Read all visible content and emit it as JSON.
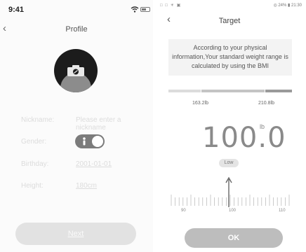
{
  "profile_screen": {
    "status": {
      "time": "9:41"
    },
    "title": "Profile",
    "fields": {
      "nickname": {
        "label": "Nickname:",
        "placeholder": "Please enter a nickname"
      },
      "gender": {
        "label": "Gender:",
        "value": "male"
      },
      "birthday": {
        "label": "Birthday:",
        "value": "2001-01-01"
      },
      "height": {
        "label": "Height:",
        "value": "180cm"
      }
    },
    "next_label": "Next"
  },
  "target_screen": {
    "status": {
      "left_icons": "□ □ ☀ ▣",
      "right": "◎ 24% ▮ 21:30"
    },
    "title": "Target",
    "info_text": "According to your physical information,Your standard weight range is calculated by using the BMI",
    "range": {
      "min_label": "163.2lb",
      "max_label": "210.8lb"
    },
    "weight": {
      "value": "100.0",
      "unit": "lb",
      "status": "Low"
    },
    "ruler": {
      "labels": [
        "90",
        "100",
        "110"
      ],
      "selected": 100,
      "min": 90,
      "max": 110
    },
    "ok_label": "OK"
  },
  "colors": {
    "accent_gray": "#8a8a8a",
    "button_gray": "#bdbdbd",
    "toggle_gray": "#7b7b7b"
  }
}
